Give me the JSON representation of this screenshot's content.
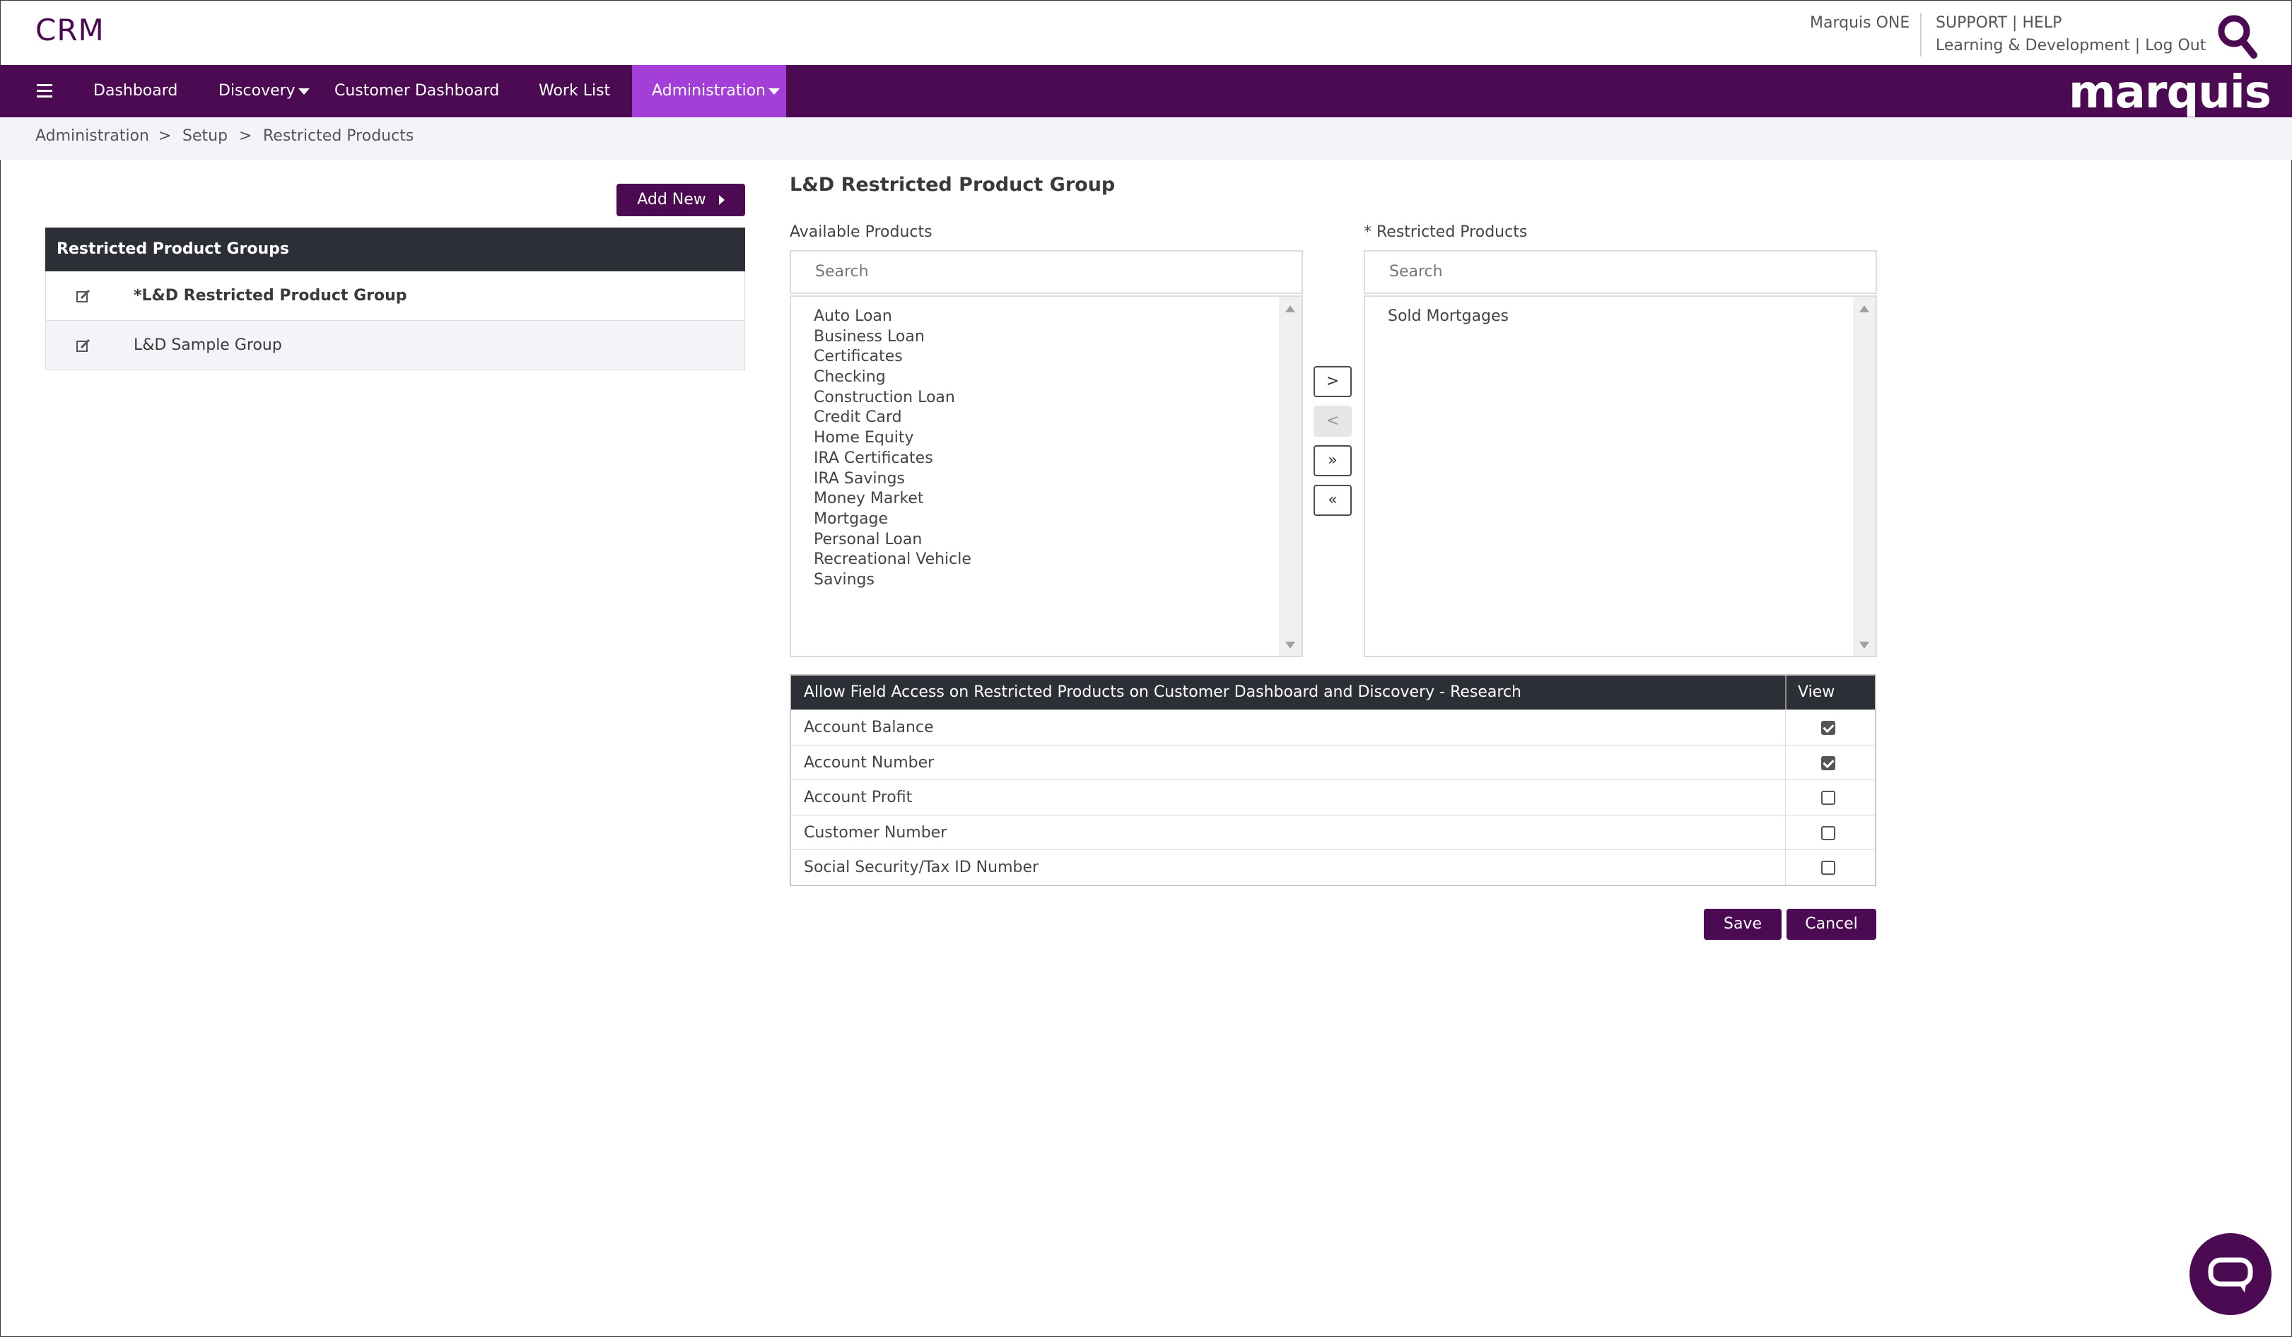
{
  "header": {
    "app_title": "CRM",
    "brand": "Marquis ONE",
    "support": "SUPPORT",
    "help": "HELP",
    "learning": "Learning & Development",
    "logout": "Log Out",
    "sep": "|",
    "logo_text": "marquis"
  },
  "nav": {
    "items": [
      "Dashboard",
      "Discovery",
      "Customer Dashboard",
      "Work List",
      "Administration"
    ],
    "active": "Administration"
  },
  "breadcrumb": {
    "items": [
      "Administration",
      "Setup",
      "Restricted Products"
    ],
    "separator": ">"
  },
  "left_panel": {
    "add_new_label": "Add New",
    "header": "Restricted Product Groups",
    "groups": [
      "*L&D Restricted Product Group",
      "L&D Sample Group"
    ]
  },
  "main": {
    "title": "L&D Restricted Product Group",
    "available_label": "Available Products",
    "restricted_label": "* Restricted Products",
    "search_placeholder": "Search",
    "available_products": [
      "Auto Loan",
      "Business Loan",
      "Certificates",
      "Checking",
      "Construction Loan",
      "Credit Card",
      "Home Equity",
      "IRA Certificates",
      "IRA Savings",
      "Money Market",
      "Mortgage",
      "Personal Loan",
      "Recreational Vehicle",
      "Savings"
    ],
    "restricted_products": [
      "Sold Mortgages"
    ],
    "move_buttons": [
      ">",
      "<",
      "»",
      "«"
    ]
  },
  "field_access": {
    "header": "Allow Field Access on Restricted Products on Customer Dashboard and Discovery - Research",
    "view_header": "View",
    "rows": [
      {
        "label": "Account Balance",
        "checked": true
      },
      {
        "label": "Account Number",
        "checked": true
      },
      {
        "label": "Account Profit",
        "checked": false
      },
      {
        "label": "Customer Number",
        "checked": false
      },
      {
        "label": "Social Security/Tax ID Number",
        "checked": false
      }
    ]
  },
  "actions": {
    "save": "Save",
    "cancel": "Cancel"
  },
  "colors": {
    "brand": "#4b0a52",
    "nav_active": "#a33fd8",
    "table_header": "#2c2f36"
  }
}
